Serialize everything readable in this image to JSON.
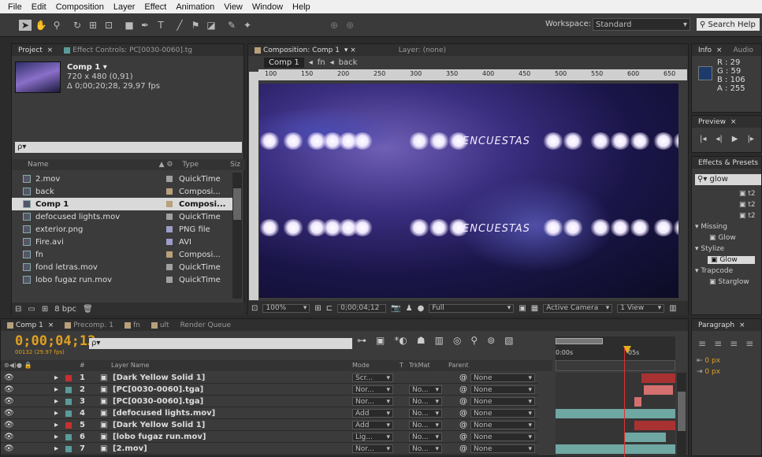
{
  "menu": [
    "File",
    "Edit",
    "Composition",
    "Layer",
    "Effect",
    "Animation",
    "View",
    "Window",
    "Help"
  ],
  "toolbar": {
    "workspace_label": "Workspace:",
    "workspace_value": "Standard",
    "search_placeholder": "Search Help"
  },
  "project": {
    "tab_project": "Project",
    "tab_effects": "Effect Controls: PC[0030-0060].tg",
    "comp_name": "Comp 1 ▾",
    "comp_size": "720 x 480 (0,91)",
    "comp_duration": "Δ 0;00;20;28, 29,97 fps",
    "search_placeholder": "ρ▾",
    "col_name": "Name",
    "col_type": "Type",
    "col_size": "Siz",
    "bpc": "8 bpc",
    "items": [
      {
        "name": "2.mov",
        "type": "QuickTime",
        "color": "#a0a0a0"
      },
      {
        "name": "back",
        "type": "Composi...",
        "color": "#b8a07a"
      },
      {
        "name": "Comp 1",
        "type": "Composi...",
        "color": "#b8a07a"
      },
      {
        "name": "defocused lights.mov",
        "type": "QuickTime",
        "color": "#a0a0a0"
      },
      {
        "name": "exterior.png",
        "type": "PNG file",
        "color": "#9d9dc8"
      },
      {
        "name": "Fire.avi",
        "type": "AVI",
        "color": "#9d9dc8"
      },
      {
        "name": "fn",
        "type": "Composi...",
        "color": "#b8a07a"
      },
      {
        "name": "fond letras.mov",
        "type": "QuickTime",
        "color": "#a0a0a0"
      },
      {
        "name": "lobo fugaz run.mov",
        "type": "QuickTime",
        "color": "#a0a0a0"
      }
    ]
  },
  "composition": {
    "tab": "Composition: Comp 1",
    "tab_layer": "Layer: (none)",
    "crumb1": "Comp 1",
    "crumb2": "fn",
    "crumb3": "back",
    "ruler_ticks": [
      "100",
      "150",
      "200",
      "250",
      "300",
      "350",
      "400",
      "450",
      "500",
      "550",
      "600",
      "650"
    ],
    "zoom": "100%",
    "timecode": "0;00;04;12",
    "resolution": "Full",
    "camera": "Active Camera",
    "view": "1 View",
    "overlay_text_1": "ENCUESTAS",
    "overlay_text_2": "ENCUESTAS"
  },
  "info": {
    "tab": "Info",
    "tab2": "Audio",
    "r": "R : 29",
    "g": "G : 59",
    "b": "B : 106",
    "a": "A : 255",
    "swatch": "#1d3b6a"
  },
  "preview": {
    "tab": "Preview"
  },
  "effects": {
    "tab": "Effects & Presets",
    "search": "glow",
    "items": [
      {
        "label": "t2",
        "kind": "item"
      },
      {
        "label": "t2",
        "kind": "item"
      },
      {
        "label": "t2",
        "kind": "item"
      },
      {
        "label": "▾ Missing",
        "kind": "group"
      },
      {
        "label": "Glow",
        "kind": "item"
      },
      {
        "label": "▾ Stylize",
        "kind": "group"
      },
      {
        "label": "Glow",
        "kind": "selected"
      },
      {
        "label": "▾ Trapcode",
        "kind": "group"
      },
      {
        "label": "Starglow",
        "kind": "item"
      }
    ]
  },
  "paragraph": {
    "tab": "Paragraph",
    "px1": "0 px",
    "px2": "0 px"
  },
  "timeline": {
    "tabs": [
      {
        "label": "Comp 1",
        "color": "#b8a07a",
        "active": true
      },
      {
        "label": "Precomp. 1",
        "color": "#b8a07a",
        "active": false
      },
      {
        "label": "fn",
        "color": "#b8a07a",
        "active": false
      },
      {
        "label": "ult",
        "color": "#b8a07a",
        "active": false
      },
      {
        "label": "Render Queue",
        "color": "",
        "active": false
      }
    ],
    "timecode": "0;00;04;12",
    "fps": "00132 (29.97 fps)",
    "search": "ρ▾",
    "col_hash": "#",
    "col_layer": "Layer Name",
    "col_mode": "Mode",
    "col_t": "T",
    "col_trkmat": "TrkMat",
    "col_parent": "Parent",
    "ruler_0": "0:00s",
    "ruler_5": "05s",
    "layers": [
      {
        "num": "1",
        "name": "[Dark Yellow Solid 1]",
        "mode": "Scr...",
        "trk": "",
        "parent": "None",
        "label": "#c83030",
        "bar": "#a83232",
        "start": 0.72,
        "end": 1.0
      },
      {
        "num": "2",
        "name": "[PC[0030-0060].tga]",
        "mode": "Nor...",
        "trk": "No...",
        "parent": "None",
        "label": "#5a9a9a",
        "bar": "#d47070",
        "start": 0.74,
        "end": 0.98
      },
      {
        "num": "3",
        "name": "[PC[0030-0060].tga]",
        "mode": "Nor...",
        "trk": "No...",
        "parent": "None",
        "label": "#5a9a9a",
        "bar": "#d47070",
        "start": 0.66,
        "end": 0.72
      },
      {
        "num": "4",
        "name": "[defocused lights.mov]",
        "mode": "Add",
        "trk": "No...",
        "parent": "None",
        "label": "#5a9a9a",
        "bar": "#6fa7a3",
        "start": 0.0,
        "end": 1.0
      },
      {
        "num": "5",
        "name": "[Dark Yellow Solid 1]",
        "mode": "Add",
        "trk": "No...",
        "parent": "None",
        "label": "#c83030",
        "bar": "#a83232",
        "start": 0.66,
        "end": 1.0
      },
      {
        "num": "6",
        "name": "[lobo fugaz run.mov]",
        "mode": "Lig...",
        "trk": "No...",
        "parent": "None",
        "label": "#5a9a9a",
        "bar": "#6fa7a3",
        "start": 0.58,
        "end": 0.92
      },
      {
        "num": "7",
        "name": "[2.mov]",
        "mode": "Nor...",
        "trk": "No...",
        "parent": "None",
        "label": "#5a9a9a",
        "bar": "#6fa7a3",
        "start": 0.0,
        "end": 1.0
      }
    ]
  }
}
